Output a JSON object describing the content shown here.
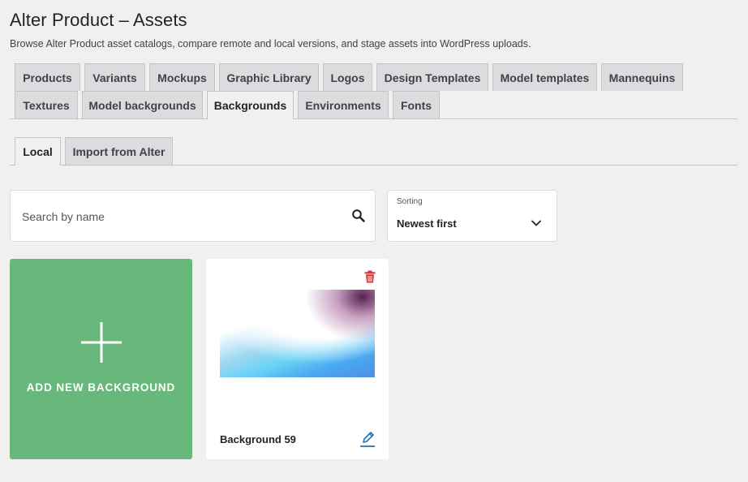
{
  "page": {
    "title": "Alter Product – Assets",
    "description": "Browse Alter Product asset catalogs, compare remote and local versions, and stage assets into WordPress uploads."
  },
  "main_tabs": [
    {
      "label": "Products"
    },
    {
      "label": "Variants"
    },
    {
      "label": "Mockups"
    },
    {
      "label": "Graphic Library"
    },
    {
      "label": "Logos"
    },
    {
      "label": "Design Templates"
    },
    {
      "label": "Model templates"
    },
    {
      "label": "Mannequins"
    },
    {
      "label": "Textures"
    },
    {
      "label": "Model backgrounds"
    },
    {
      "label": "Backgrounds",
      "active": true
    },
    {
      "label": "Environments"
    },
    {
      "label": "Fonts"
    }
  ],
  "sub_tabs": [
    {
      "label": "Local",
      "active": true
    },
    {
      "label": "Import from Alter"
    }
  ],
  "search": {
    "placeholder": "Search by name",
    "value": ""
  },
  "sorting": {
    "label": "Sorting",
    "value": "Newest first"
  },
  "add_card": {
    "label": "ADD NEW BACKGROUND"
  },
  "backgrounds": [
    {
      "name": "Background 59"
    }
  ],
  "colors": {
    "add_card_bg": "#67b87a",
    "trash": "#d63638",
    "edit": "#2271b1"
  }
}
